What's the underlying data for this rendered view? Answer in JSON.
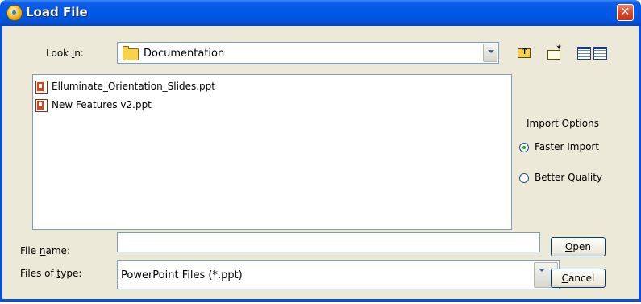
{
  "window": {
    "title": "Load File"
  },
  "look_in": {
    "label_pre": "Look ",
    "label_key": "i",
    "label_post": "n:",
    "value": "Documentation",
    "icon": "folder-icon"
  },
  "toolbar": {
    "icons": [
      "up-one-level-icon",
      "create-new-folder-icon",
      "list-view-icon",
      "details-view-icon"
    ]
  },
  "files": [
    {
      "name": "Elluminate_Orientation_Slides.ppt",
      "icon": "powerpoint-file-icon"
    },
    {
      "name": "New Features v2.ppt",
      "icon": "powerpoint-file-icon"
    }
  ],
  "import_options": {
    "title": "Import Options",
    "options": [
      {
        "label": "Faster Import",
        "selected": true
      },
      {
        "label": "Better Quality",
        "selected": false
      }
    ]
  },
  "file_name": {
    "label_pre": "File ",
    "label_key": "n",
    "label_post": "ame:",
    "value": ""
  },
  "files_of_type": {
    "label_pre": "Files of ",
    "label_key": "t",
    "label_post": "ype:",
    "value": "PowerPoint Files (*.ppt)"
  },
  "buttons": {
    "open": {
      "key": "O",
      "rest": "pen"
    },
    "cancel": {
      "key": "C",
      "rest": "ancel"
    }
  },
  "colors": {
    "titlebar": "#0058e6",
    "dialog_bg": "#ece9d8",
    "close_button": "#d8492a",
    "radio_selected": "#21a121"
  }
}
